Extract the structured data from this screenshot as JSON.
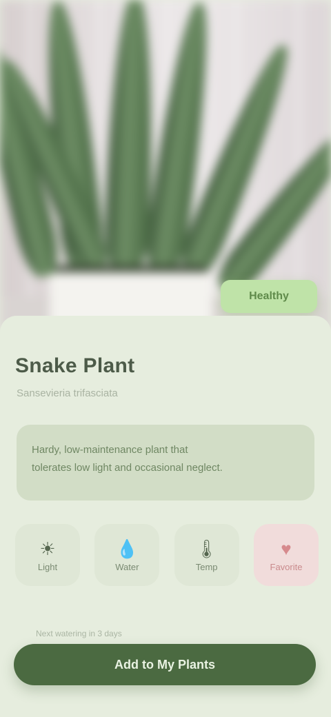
{
  "hero": {
    "image": "snake-plant-photo"
  },
  "badge": {
    "label": "Healthy"
  },
  "plant": {
    "name": "Snake Plant",
    "scientific": "Sansevieria trifasciata"
  },
  "info": {
    "lines": [
      "Hardy, low-maintenance plant that",
      "tolerates low light and occasional neglect."
    ]
  },
  "care": [
    {
      "icon": "sun-icon",
      "glyph": "☀",
      "label": "Light"
    },
    {
      "icon": "water-drop-icon",
      "glyph": "💧",
      "label": "Water"
    },
    {
      "icon": "thermometer-icon",
      "glyph": "🌡",
      "label": "Temp"
    },
    {
      "icon": "heart-icon",
      "glyph": "♥",
      "label": "Favorite"
    }
  ],
  "caption": "Next watering in 3 days",
  "cta": {
    "label": "Add to My Plants"
  },
  "colors": {
    "accent": "#4b6a41",
    "badge": "#bfe3a8",
    "sheet": "#e6edde"
  }
}
